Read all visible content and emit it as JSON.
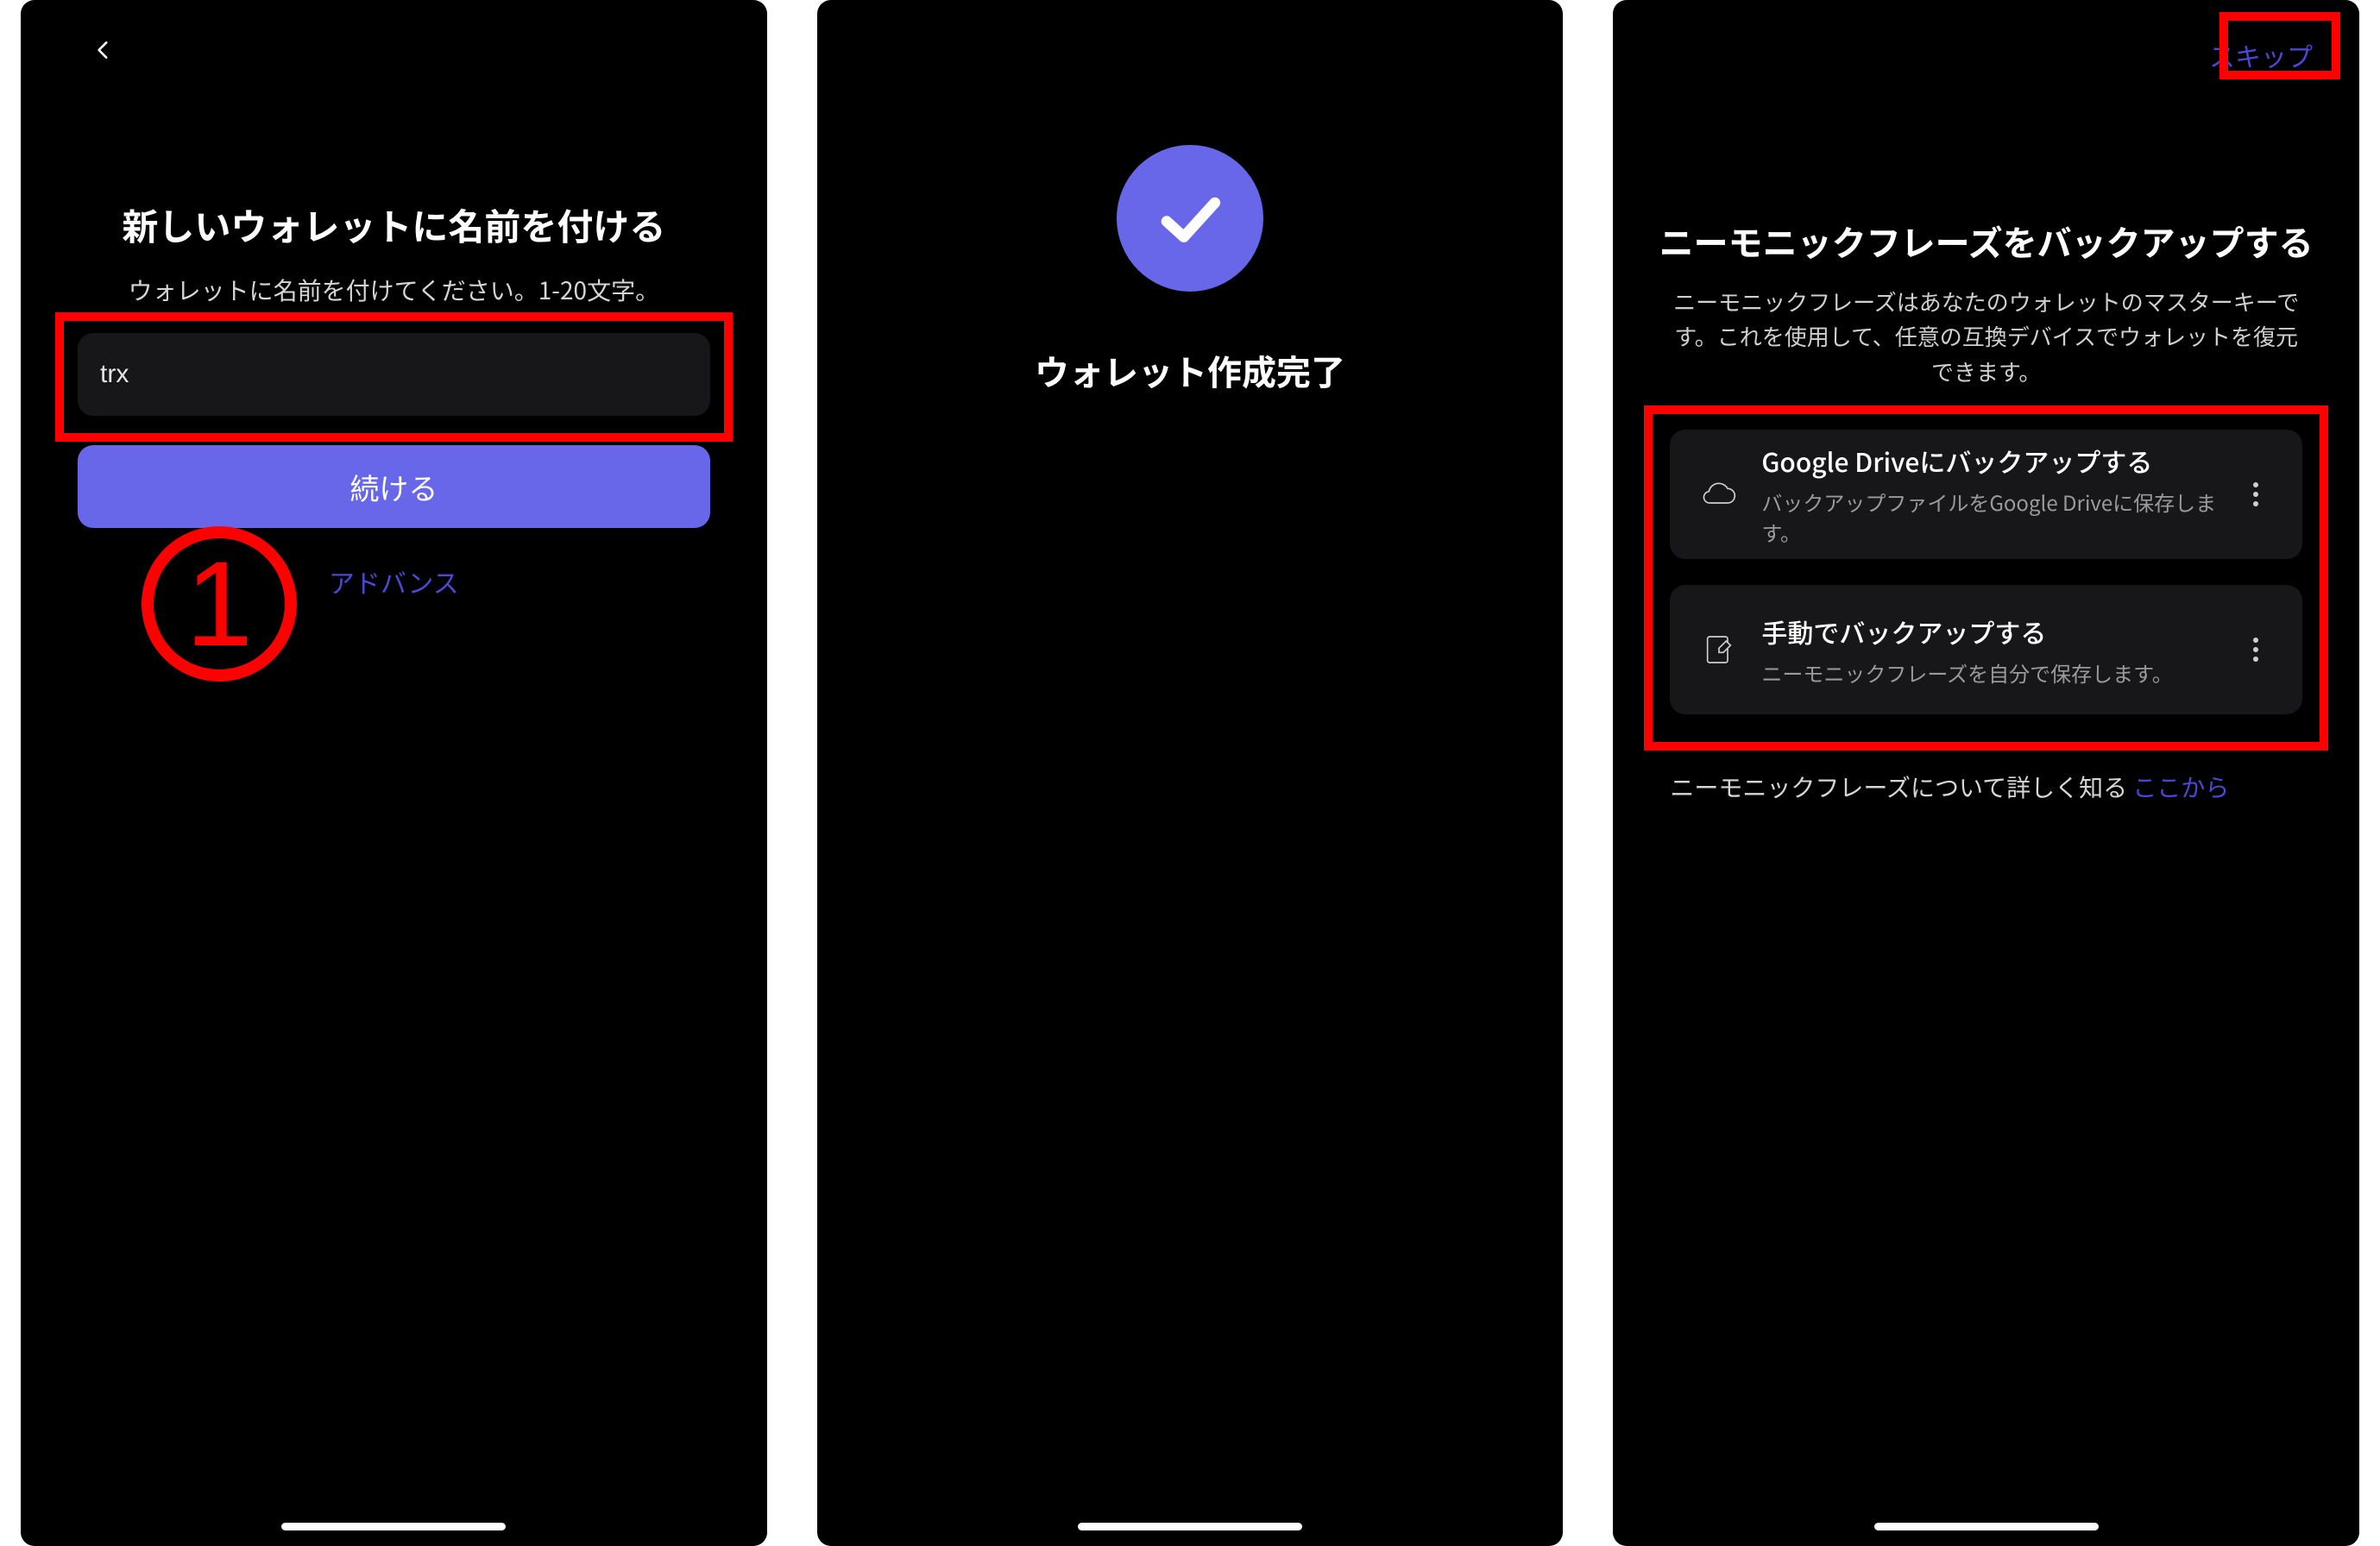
{
  "screen1": {
    "title": "新しいウォレットに名前を付ける",
    "subtitle": "ウォレットに名前を付けてください。1-20文字。",
    "input_value": "trx",
    "continue": "続ける",
    "advance": "アドバンス",
    "step_number": "1"
  },
  "screen2": {
    "title": "ウォレット作成完了"
  },
  "screen3": {
    "skip": "スキップ",
    "title": "ニーモニックフレーズをバックアップする",
    "subtitle": "ニーモニックフレーズはあなたのウォレットのマスターキーです。これを使用して、任意の互換デバイスでウォレットを復元できます。",
    "option_gdrive": {
      "title": "Google Driveにバックアップする",
      "desc": "バックアップファイルをGoogle Driveに保存します。"
    },
    "option_manual": {
      "title": "手動でバックアップする",
      "desc": "ニーモニックフレーズを自分で保存します。"
    },
    "learn_prefix": "ニーモニックフレーズについて詳しく知る ",
    "learn_link": "ここから"
  }
}
